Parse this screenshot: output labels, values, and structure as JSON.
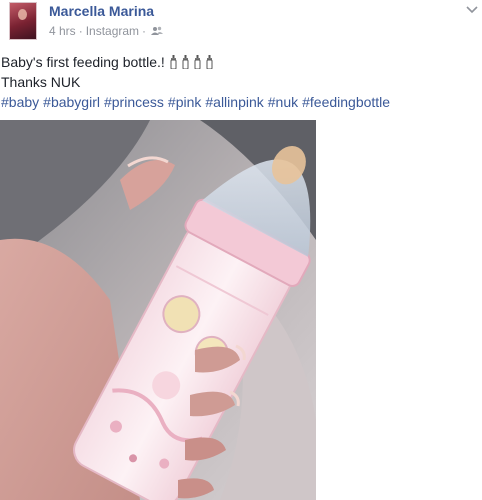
{
  "post": {
    "author": "Marcella Marina",
    "time": "4 hrs",
    "source": "Instagram",
    "separator": "·",
    "audience_icon": "friends-icon",
    "menu_icon": "chevron-down-icon",
    "caption_line1": "Baby's first feeding bottle.!",
    "caption_emoji_count": 4,
    "caption_line2": "Thanks NUK",
    "hashtags": [
      "#baby",
      "#babygirl",
      "#princess",
      "#pink",
      "#allinpink",
      "#nuk",
      "#feedingbottle"
    ],
    "photo_description_icon": "photo",
    "colors": {
      "link": "#3b5998",
      "meta": "#90949c",
      "text": "#1d2129"
    }
  }
}
